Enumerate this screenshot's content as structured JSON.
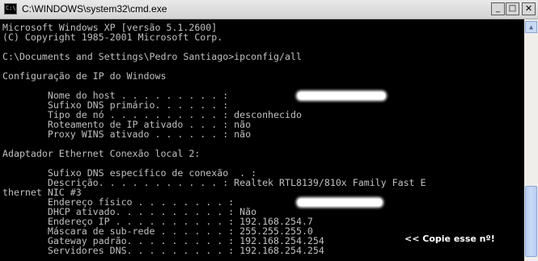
{
  "window": {
    "title": "C:\\WINDOWS\\system32\\cmd.exe",
    "minimize_glyph": "_",
    "maximize_glyph": "□",
    "close_glyph": "✕"
  },
  "console": {
    "lines": [
      "Microsoft Windows XP [versão 5.1.2600]",
      "(C) Copyright 1985-2001 Microsoft Corp.",
      "",
      "C:\\Documents and Settings\\Pedro Santiago>ipconfig/all",
      "",
      "Configuração de IP do Windows",
      "",
      "        Nome do host . . . . . . . . . :",
      "        Sufixo DNS primário. . . . . . :",
      "        Tipo de nó . . . . . . . . . . : desconhecido",
      "        Roteamento de IP ativado . . . : não",
      "        Proxy WINS ativado . . . . . . : não",
      "",
      "Adaptador Ethernet Conexão local 2:",
      "",
      "        Sufixo DNS específico de conexão  . :",
      "        Descrição. . . . . . . . . . . : Realtek RTL8139/810x Family Fast E",
      "thernet NIC #3",
      "        Endereço físico . . . . . . . . :",
      "        DHCP ativado. . . . . . . . . . : Não",
      "        Endereço IP . . . . . . . . . . : 192.168.254.7",
      "        Máscara de sub-rede . . . . . . : 255.255.255.0",
      "        Gateway padrão. . . . . . . . . : 192.168.254.254",
      "        Servidores DNS. . . . . . . . . : 192.168.254.254"
    ],
    "annotation": "<< Copie esse nº!"
  },
  "colors": {
    "console_background": "#000000",
    "console_text": "#c0c0c0",
    "annotation_text": "#ffffff"
  },
  "icons": {
    "app": "cmd-icon",
    "scroll_up": "arrow-up-icon"
  }
}
